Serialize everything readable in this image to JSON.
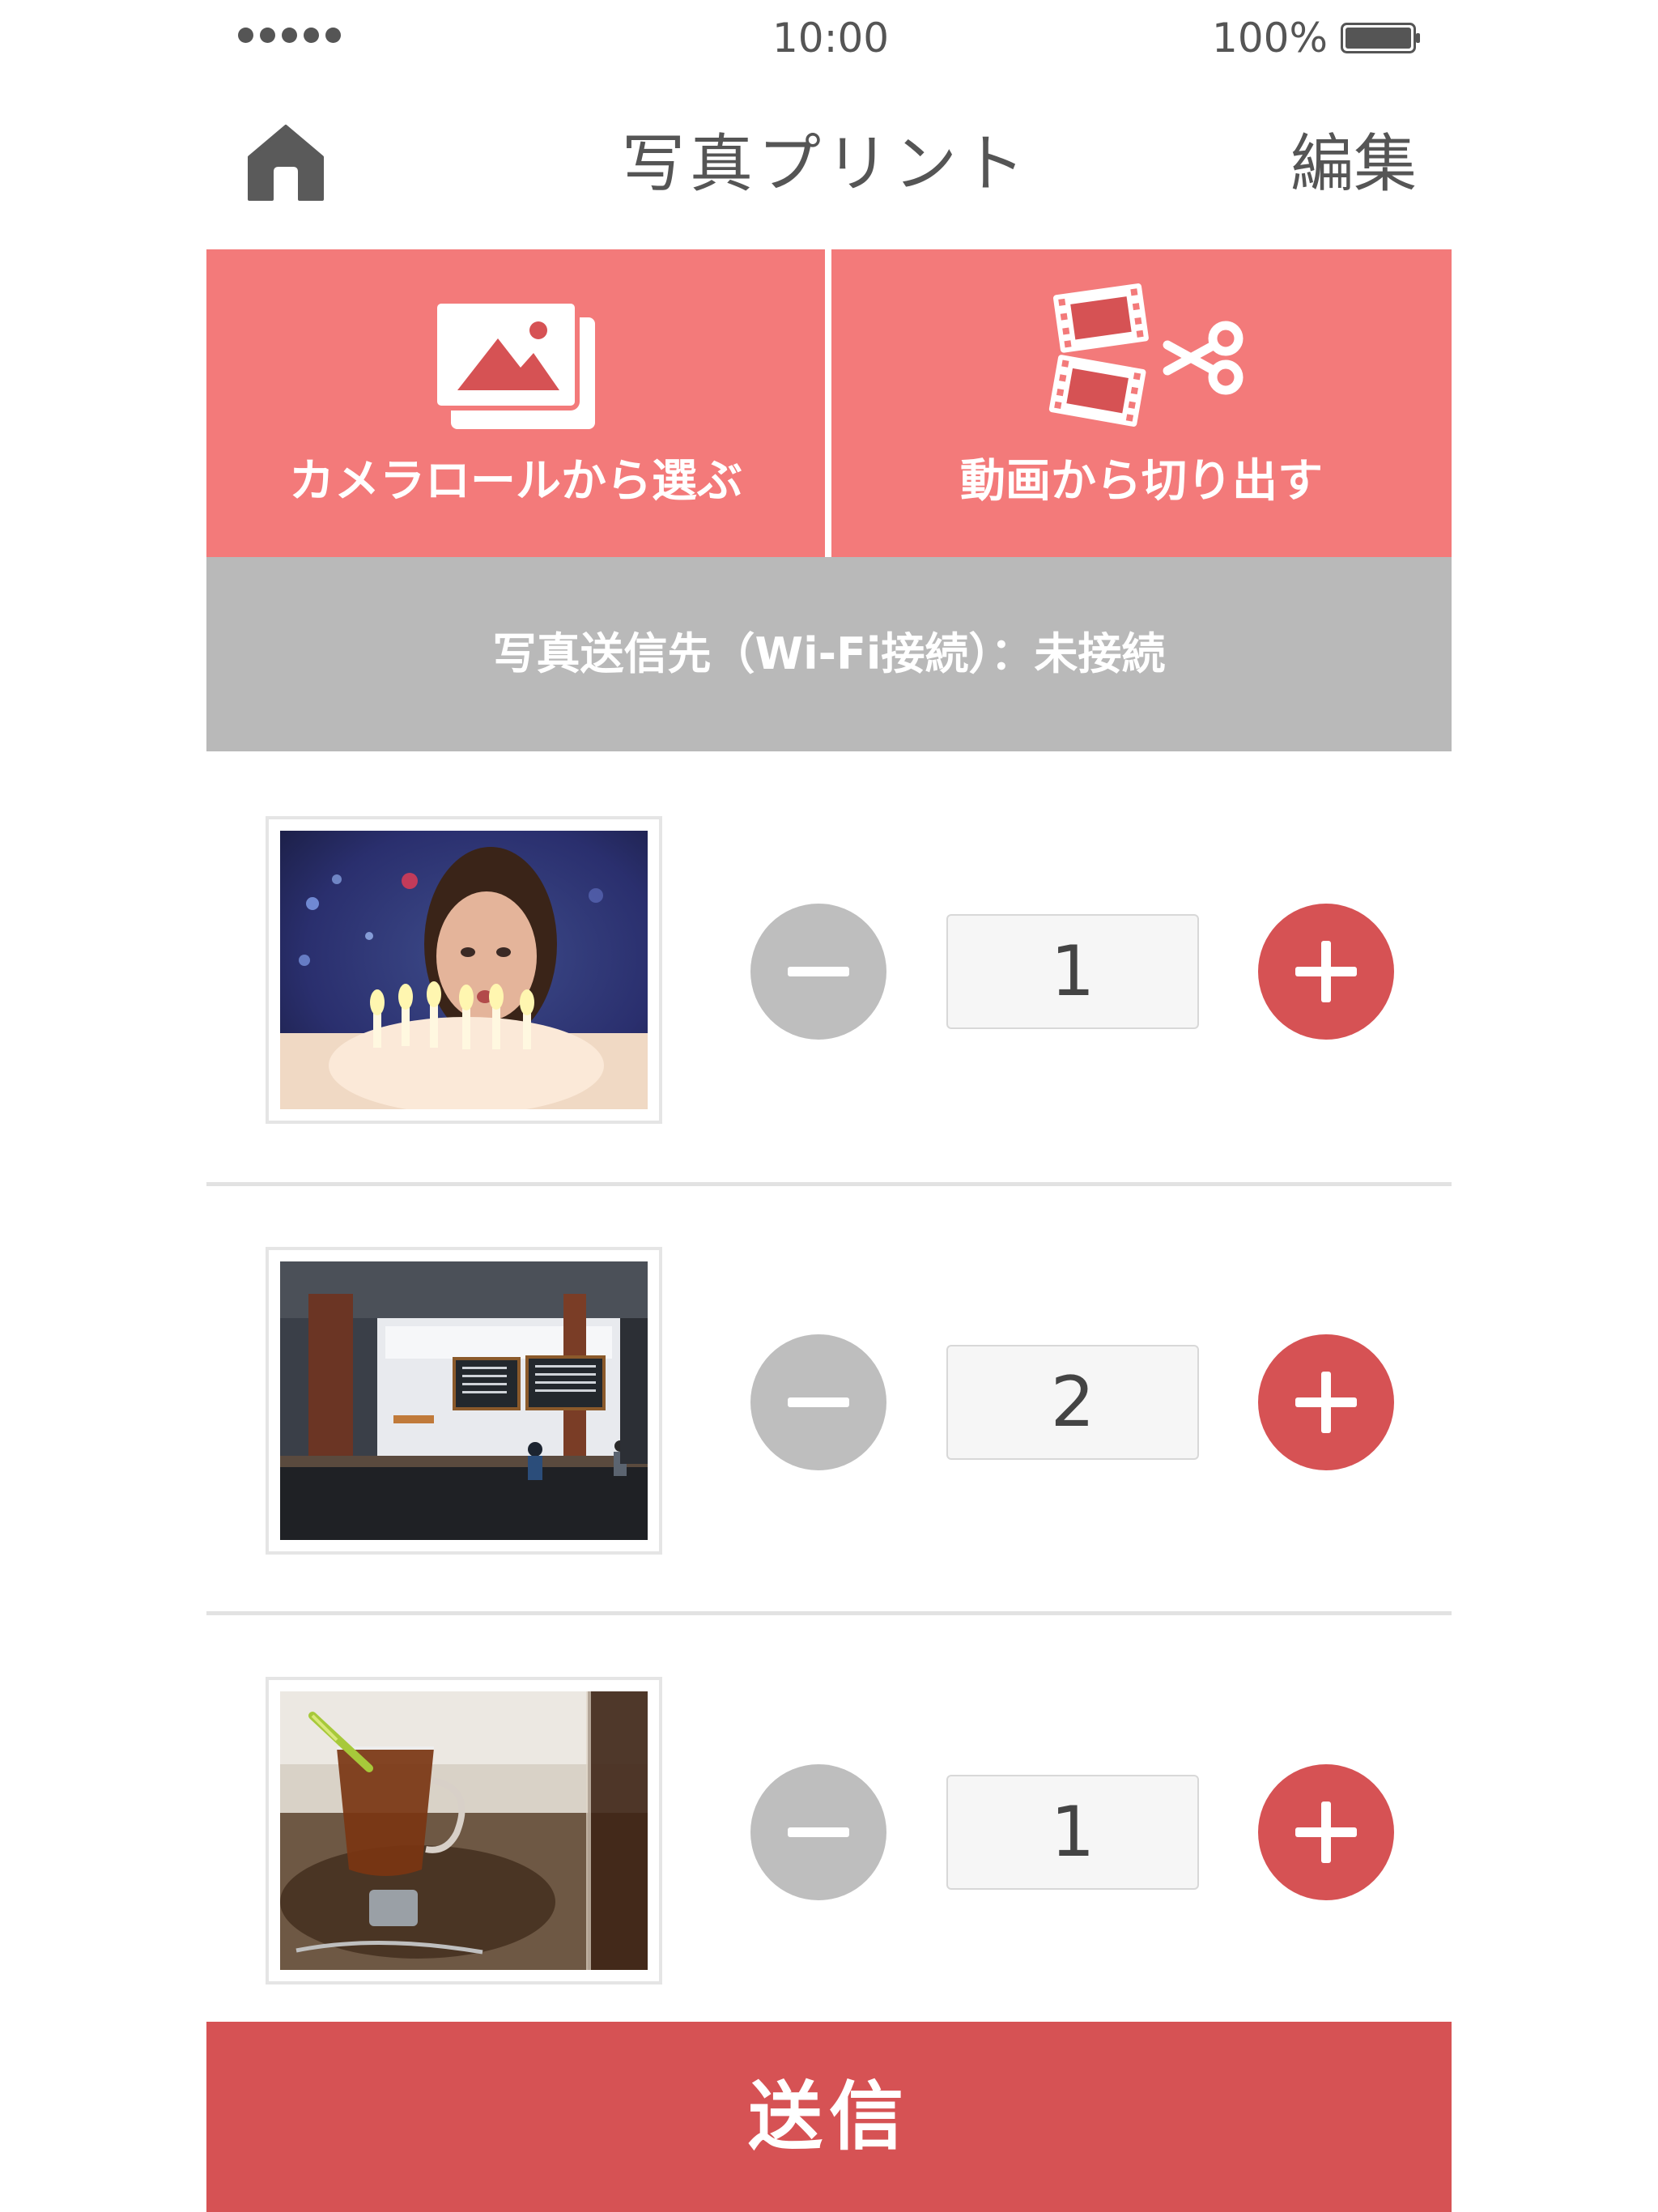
{
  "status_bar": {
    "time": "10:00",
    "battery": "100%"
  },
  "nav": {
    "title": "写真プリント",
    "edit_label": "編集",
    "home_icon": "home-icon"
  },
  "actions": {
    "camera_roll_label": "カメラロールから選ぶ",
    "camera_roll_icon": "photo-gallery-icon",
    "video_cut_label": "動画から切り出す",
    "video_cut_icon": "film-scissors-icon"
  },
  "wifi": {
    "text": "写真送信先（Wi-Fi接続）：未接続"
  },
  "photos": [
    {
      "quantity": "1",
      "subject": "girl with birthday cake"
    },
    {
      "quantity": "2",
      "subject": "cafe interior"
    },
    {
      "quantity": "1",
      "subject": "tea in glass cup"
    }
  ],
  "send_label": "送信",
  "colors": {
    "action_bg": "#f37a7a",
    "accent": "#d65254",
    "wifi_bg": "#b9b9b9",
    "minus_bg": "#bebebe"
  }
}
